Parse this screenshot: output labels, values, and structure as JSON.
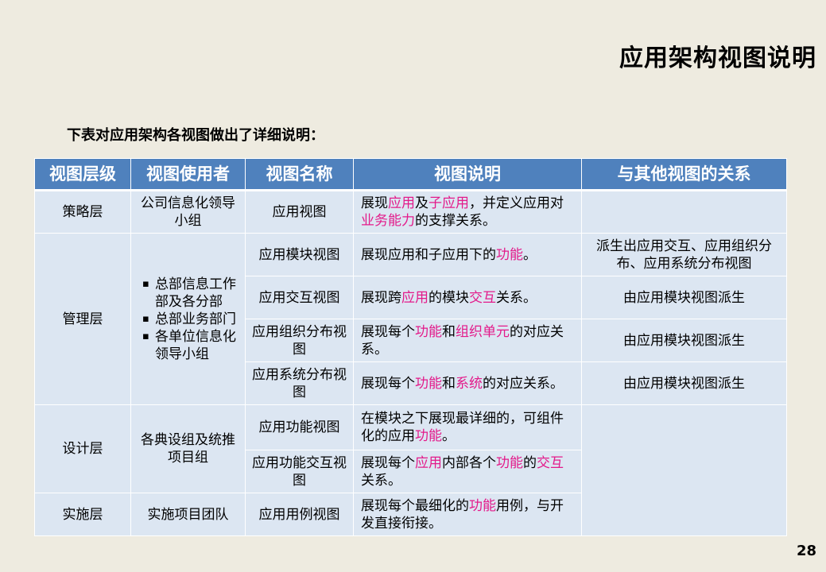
{
  "title": "应用架构视图说明",
  "intro": "下表对应用架构各视图做出了详细说明：",
  "table": {
    "headers": [
      "视图层级",
      "视图使用者",
      "视图名称",
      "视图说明",
      "与其他视图的关系"
    ],
    "rows": [
      {
        "level": "策略层",
        "user": "公司信息化领导小组",
        "name": "应用视图",
        "desc": [
          {
            "t": "展现"
          },
          {
            "t": "应用",
            "hl": true
          },
          {
            "t": "及"
          },
          {
            "t": "子应用",
            "hl": true
          },
          {
            "t": "，并定义应用对"
          },
          {
            "t": "业务能力",
            "hl": true
          },
          {
            "t": "的支撑关系。"
          }
        ],
        "relation": ""
      },
      {
        "level": "管理层",
        "user_list": [
          "总部信息工作部及各分部",
          "总部业务部门",
          "各单位信息化领导小组"
        ],
        "name": "应用模块视图",
        "desc": [
          {
            "t": "展现应用和子应用下的"
          },
          {
            "t": "功能",
            "hl": true
          },
          {
            "t": "。"
          }
        ],
        "relation": "派生出应用交互、应用组织分布、应用系统分布视图"
      },
      {
        "name": "应用交互视图",
        "desc": [
          {
            "t": "展现跨"
          },
          {
            "t": "应用",
            "hl": true
          },
          {
            "t": "的模块"
          },
          {
            "t": "交互",
            "hl": true
          },
          {
            "t": "关系。"
          }
        ],
        "relation": "由应用模块视图派生"
      },
      {
        "name": "应用组织分布视图",
        "desc": [
          {
            "t": "展现每个"
          },
          {
            "t": "功能",
            "hl": true
          },
          {
            "t": "和"
          },
          {
            "t": "组织单元",
            "hl": true
          },
          {
            "t": "的对应关系。"
          }
        ],
        "relation": "由应用模块视图派生"
      },
      {
        "name": "应用系统分布视图",
        "desc": [
          {
            "t": "展现每个"
          },
          {
            "t": "功能",
            "hl": true
          },
          {
            "t": "和"
          },
          {
            "t": "系统",
            "hl": true
          },
          {
            "t": "的对应关系。"
          }
        ],
        "relation": "由应用模块视图派生"
      },
      {
        "level": "设计层",
        "user": "各典设组及统推项目组",
        "name": "应用功能视图",
        "desc": [
          {
            "t": "在模块之下展现最详细的，可组件化的应用"
          },
          {
            "t": "功能",
            "hl": true
          },
          {
            "t": "。"
          }
        ],
        "relation": ""
      },
      {
        "name": "应用功能交互视图",
        "desc": [
          {
            "t": "展现每个"
          },
          {
            "t": "应用",
            "hl": true
          },
          {
            "t": "内部各个"
          },
          {
            "t": "功能",
            "hl": true
          },
          {
            "t": "的"
          },
          {
            "t": "交互",
            "hl": true
          },
          {
            "t": "关系。"
          }
        ]
      },
      {
        "level": "实施层",
        "user": "实施项目团队",
        "name": "应用用例视图",
        "desc": [
          {
            "t": "展现每个最细化的"
          },
          {
            "t": "功能",
            "hl": true
          },
          {
            "t": "用例，与开发直接衔接。"
          }
        ]
      }
    ]
  },
  "colors": {
    "header_bg": "#4f81bd",
    "cell_bg": "#dce6f2",
    "highlight": "#e31a8a",
    "page_bg": "#eeebe0"
  },
  "page_number": "28"
}
